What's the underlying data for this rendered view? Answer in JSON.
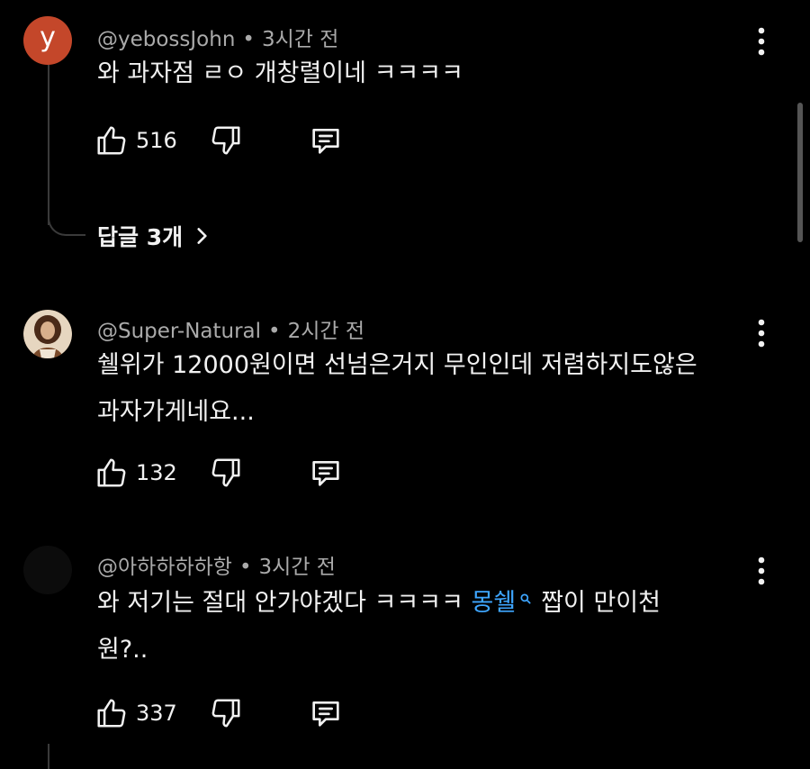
{
  "comments": [
    {
      "author": "@yebossJohn",
      "time": "3시간 전",
      "avatar_letter": "y",
      "avatar_color": "#c4472a",
      "text": "와 과자점 ㄹㅇ 개창렬이네 ㅋㅋㅋㅋ",
      "likes": "516",
      "replies_label": "답글 3개"
    },
    {
      "author": "@Super-Natural",
      "time": "2시간 전",
      "text_line1": "쉘위가 12000원이면 선넘은거지 무인인데 저렴하지도않은",
      "text_line2": "과자가게네요...",
      "likes": "132"
    },
    {
      "author": "@아하하하하항",
      "time": "3시간 전",
      "text_before": "와 저기는 절대 안가야겠다 ㅋㅋㅋㅋ ",
      "hashtag": "몽쉘",
      "text_after": "짭이 만이천",
      "text_line2": "원?..",
      "likes": "337"
    }
  ],
  "dot_separator": "•",
  "colors": {
    "background": "#000000",
    "text": "#f1f1f1",
    "meta": "#aaaaaa",
    "link": "#3ea6ff"
  },
  "icons": [
    "like-icon",
    "dislike-icon",
    "reply-icon",
    "more-vert-icon",
    "chevron-right-icon",
    "search-icon"
  ]
}
